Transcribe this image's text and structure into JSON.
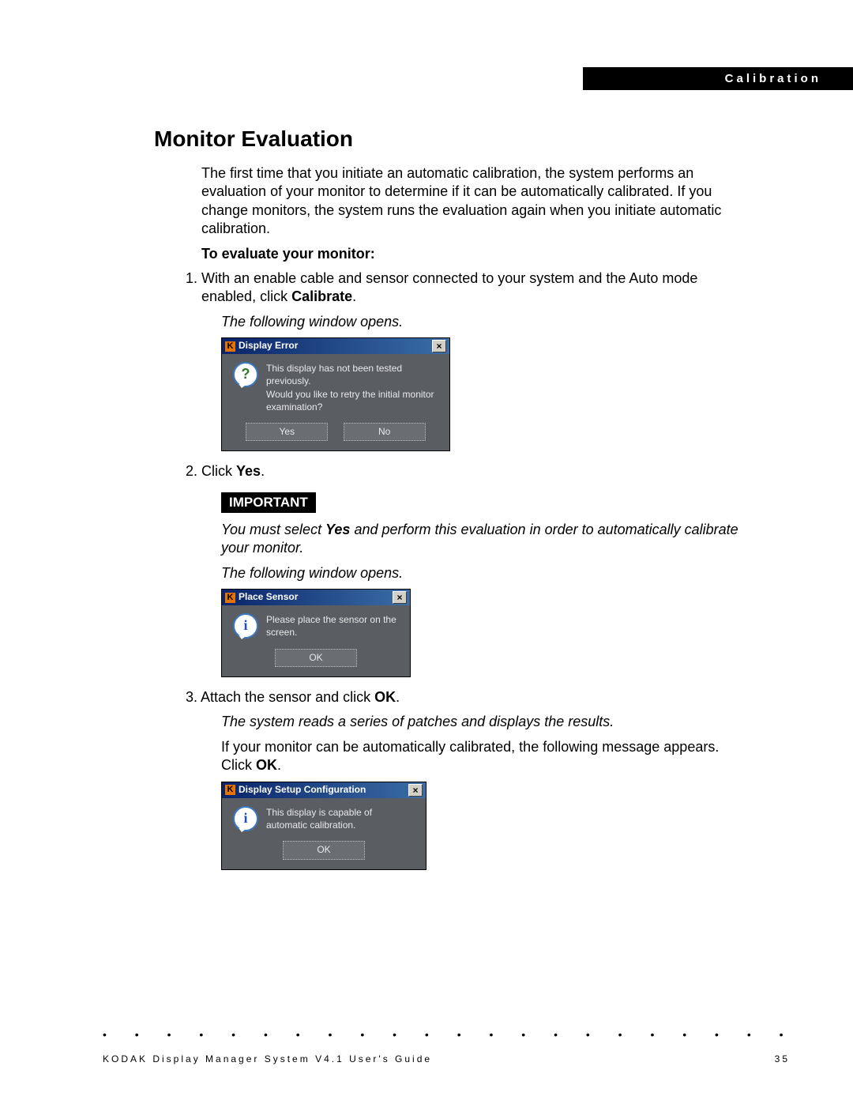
{
  "header": {
    "section": "Calibration"
  },
  "title": "Monitor Evaluation",
  "intro": "The first time that you initiate an automatic calibration, the system performs an evaluation of your monitor to determine if it can be automatically calibrated. If you change monitors, the system runs the evaluation again when you initiate automatic calibration.",
  "subhead": "To evaluate your monitor:",
  "step1": {
    "num": "1.",
    "text_a": "With an enable cable and sensor connected to your system and the Auto mode enabled, click ",
    "text_bold": "Calibrate",
    "text_b": "."
  },
  "opens1": "The following window opens.",
  "dialog1": {
    "title": "Display Error",
    "line1": "This display has not been tested previously.",
    "line2": "Would you like to retry the initial monitor examination?",
    "yes": "Yes",
    "no": "No"
  },
  "step2": {
    "num": "2.",
    "text_a": "Click ",
    "text_bold": "Yes",
    "text_b": "."
  },
  "important_tag": "IMPORTANT",
  "important_note": {
    "a": "You must select ",
    "b": "Yes",
    "c": " and perform this evaluation in order to automatically calibrate your monitor."
  },
  "opens2": "The following window opens.",
  "dialog2": {
    "title": "Place Sensor",
    "msg": "Please place the sensor on the screen.",
    "ok": "OK"
  },
  "step3": {
    "num": "3.",
    "text_a": "Attach the sensor and click ",
    "text_bold": "OK",
    "text_b": "."
  },
  "reads": "The system reads a series of patches and displays the results.",
  "auto_msg": {
    "a": "If your monitor can be automatically calibrated, the following message appears. Click ",
    "b": "OK",
    "c": "."
  },
  "dialog3": {
    "title": "Display Setup Configuration",
    "msg": "This display is capable of automatic calibration.",
    "ok": "OK"
  },
  "footer": {
    "book": "KODAK Display Manager System V4.1 User's Guide",
    "page": "35"
  },
  "close_x": "×",
  "kodak_k": "K",
  "dots": "• • • • • • • • • • • • • • • • • • • • • • • • • • • • • • • • • • • • •"
}
